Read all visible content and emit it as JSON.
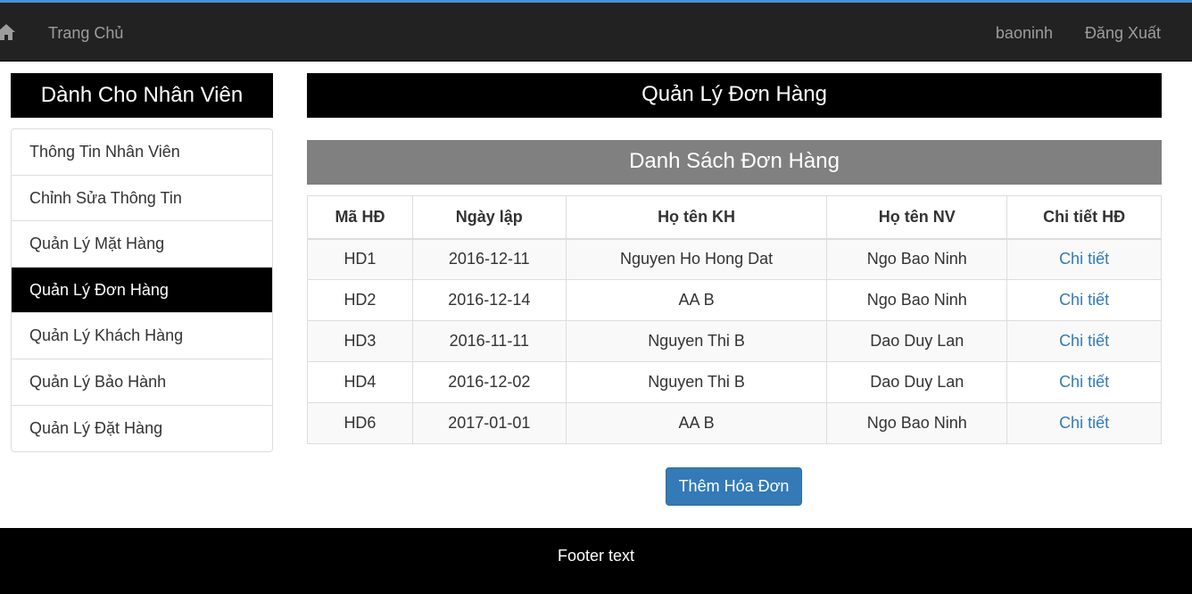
{
  "navbar": {
    "home_label": "Trang Chủ",
    "username": "baoninh",
    "logout_label": "Đăng Xuất"
  },
  "sidebar": {
    "title": "Dành Cho Nhân Viên",
    "items": [
      {
        "label": "Thông Tin Nhân Viên"
      },
      {
        "label": "Chỉnh Sửa Thông Tin"
      },
      {
        "label": "Quản Lý Mặt Hàng"
      },
      {
        "label": "Quản Lý Đơn Hàng"
      },
      {
        "label": "Quản Lý Khách Hàng"
      },
      {
        "label": "Quản Lý Bảo Hành"
      },
      {
        "label": "Quản Lý Đặt Hàng"
      }
    ],
    "active_index": 3
  },
  "main": {
    "title": "Quản Lý Đơn Hàng",
    "subtitle": "Danh Sách Đơn Hàng",
    "table": {
      "headers": [
        "Mã HĐ",
        "Ngày lập",
        "Họ tên KH",
        "Họ tên NV",
        "Chi tiết HĐ"
      ],
      "rows": [
        [
          "HD1",
          "2016-12-11",
          "Nguyen Ho Hong Dat",
          "Ngo Bao Ninh",
          "Chi tiết"
        ],
        [
          "HD2",
          "2016-12-14",
          "AA B",
          "Ngo Bao Ninh",
          "Chi tiết"
        ],
        [
          "HD3",
          "2016-11-11",
          "Nguyen Thi B",
          "Dao Duy Lan",
          "Chi tiết"
        ],
        [
          "HD4",
          "2016-12-02",
          "Nguyen Thi B",
          "Dao Duy Lan",
          "Chi tiết"
        ],
        [
          "HD6",
          "2017-01-01",
          "AA B",
          "Ngo Bao Ninh",
          "Chi tiết"
        ]
      ]
    },
    "add_button_label": "Thêm Hóa Đơn"
  },
  "footer": {
    "text": "Footer text"
  },
  "colors": {
    "navbar_bg": "#222222",
    "accent": "#337ab7",
    "active_bg": "#000000",
    "subtitle_bg": "#808080"
  },
  "icons": {
    "home": "home-icon"
  }
}
